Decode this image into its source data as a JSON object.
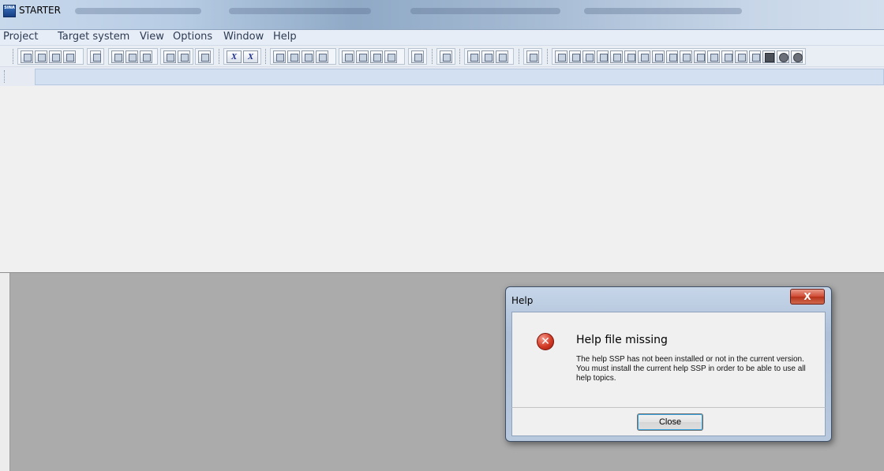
{
  "window": {
    "icon_text": "SINA",
    "title": "STARTER"
  },
  "menu": {
    "items": [
      "Project",
      "Target system",
      "View",
      "Options",
      "Window",
      "Help"
    ]
  },
  "toolbar": {
    "xi_label": "X",
    "xe_label": "X"
  },
  "dialog": {
    "title": "Help",
    "close_x": "X",
    "heading": "Help file missing",
    "message": "The help SSP has not been installed or not in the current version. You must install the current help SSP in order to be able to use all help topics.",
    "close_button": "Close",
    "icon": "error-icon"
  }
}
